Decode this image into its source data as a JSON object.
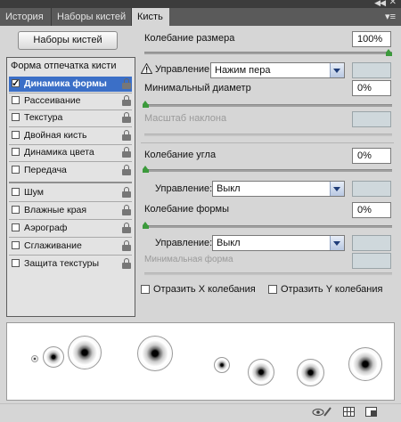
{
  "tabs": [
    "История",
    "Наборы кистей",
    "Кисть"
  ],
  "brush_presets_button": "Наборы кистей",
  "left_panel": {
    "heading": "Форма отпечатка кисти",
    "items": [
      {
        "label": "Динамика формы",
        "checked": true,
        "selected": true
      },
      {
        "label": "Рассеивание",
        "checked": false
      },
      {
        "label": "Текстура",
        "checked": false
      },
      {
        "label": "Двойная кисть",
        "checked": false
      },
      {
        "label": "Динамика цвета",
        "checked": false
      },
      {
        "label": "Передача",
        "checked": false
      },
      {
        "label": "Шум",
        "checked": false
      },
      {
        "label": "Влажные края",
        "checked": false
      },
      {
        "label": "Аэрограф",
        "checked": false
      },
      {
        "label": "Сглаживание",
        "checked": false
      },
      {
        "label": "Защита текстуры",
        "checked": false
      }
    ]
  },
  "size_jitter": {
    "label": "Колебание размера",
    "value": "100%",
    "slider": 1.0,
    "control_label": "Управление:",
    "control_value": "Нажим пера"
  },
  "min_diameter": {
    "label": "Минимальный диаметр",
    "value": "0%",
    "slider": 0
  },
  "tilt_scale": {
    "label": "Масштаб наклона"
  },
  "angle_jitter": {
    "label": "Колебание угла",
    "value": "0%",
    "slider": 0,
    "control_label": "Управление:",
    "control_value": "Выкл"
  },
  "roundness_jitter": {
    "label": "Колебание формы",
    "value": "0%",
    "slider": 0,
    "control_label": "Управление:",
    "control_value": "Выкл"
  },
  "min_roundness": {
    "label": "Минимальная форма"
  },
  "flip_x": {
    "label": "Отразить X колебания",
    "checked": false
  },
  "flip_y": {
    "label": "Отразить Y колебания",
    "checked": false
  },
  "icons": {
    "eye": "eye-brush-icon",
    "grid": "grid-icon",
    "new": "new-preset-icon"
  }
}
